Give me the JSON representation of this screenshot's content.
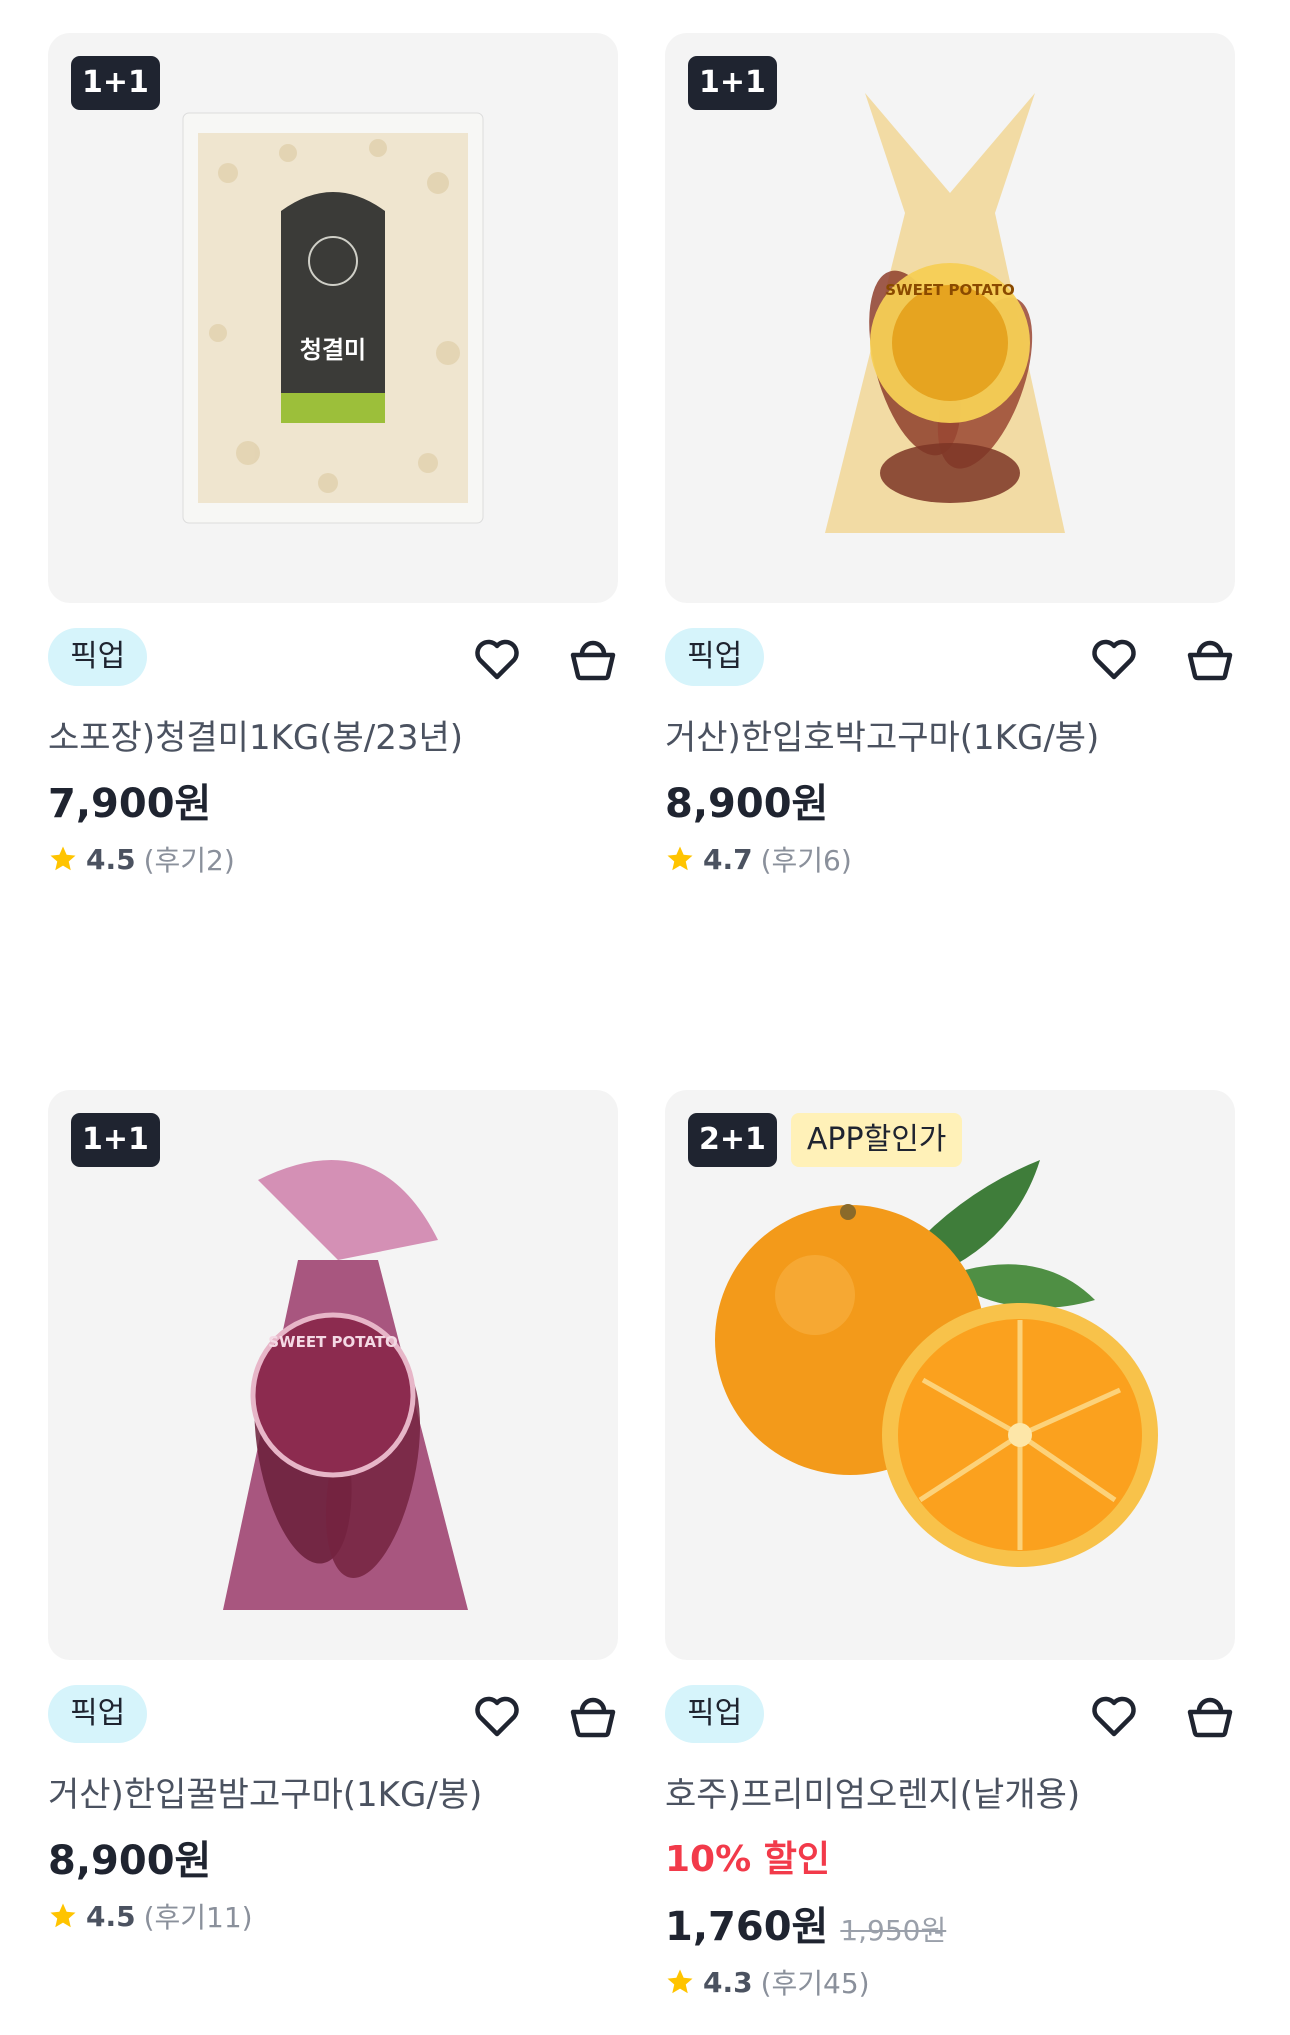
{
  "products": [
    {
      "deal_badge": "1+1",
      "app_badge": "",
      "pickup_label": "픽업",
      "title": "소포장)청결미1KG(봉/23년)",
      "discount": "",
      "price": "7,900원",
      "original_price": "",
      "rating": "4.5",
      "reviews": "(후기2)",
      "image_icon": "rice-bag-image",
      "label_text": "청결미"
    },
    {
      "deal_badge": "1+1",
      "app_badge": "",
      "pickup_label": "픽업",
      "title": "거산)한입호박고구마(1KG/봉)",
      "discount": "",
      "price": "8,900원",
      "original_price": "",
      "rating": "4.7",
      "reviews": "(후기6)",
      "image_icon": "sweet-potato-bag-image",
      "label_text": "SWEET POTATO"
    },
    {
      "deal_badge": "1+1",
      "app_badge": "",
      "pickup_label": "픽업",
      "title": "거산)한입꿀밤고구마(1KG/봉)",
      "discount": "",
      "price": "8,900원",
      "original_price": "",
      "rating": "4.5",
      "reviews": "(후기11)",
      "image_icon": "chestnut-sweet-potato-bag-image",
      "label_text": "SWEET POTATO"
    },
    {
      "deal_badge": "2+1",
      "app_badge": "APP할인가",
      "pickup_label": "픽업",
      "title": "호주)프리미엄오렌지(낱개용)",
      "discount": "10% 할인",
      "price": "1,760원",
      "original_price": "1,950원",
      "rating": "4.3",
      "reviews": "(후기45)",
      "image_icon": "orange-image",
      "label_text": ""
    }
  ],
  "icons": {
    "wishlist": "heart-icon",
    "cart": "basket-icon",
    "rating": "star-icon"
  },
  "colors": {
    "deal_badge_bg": "#1f2430",
    "pickup_chip_bg": "#d6f4fb",
    "app_badge_bg": "#fff1b8",
    "discount_text": "#f23a4a",
    "star": "#ffc400"
  }
}
